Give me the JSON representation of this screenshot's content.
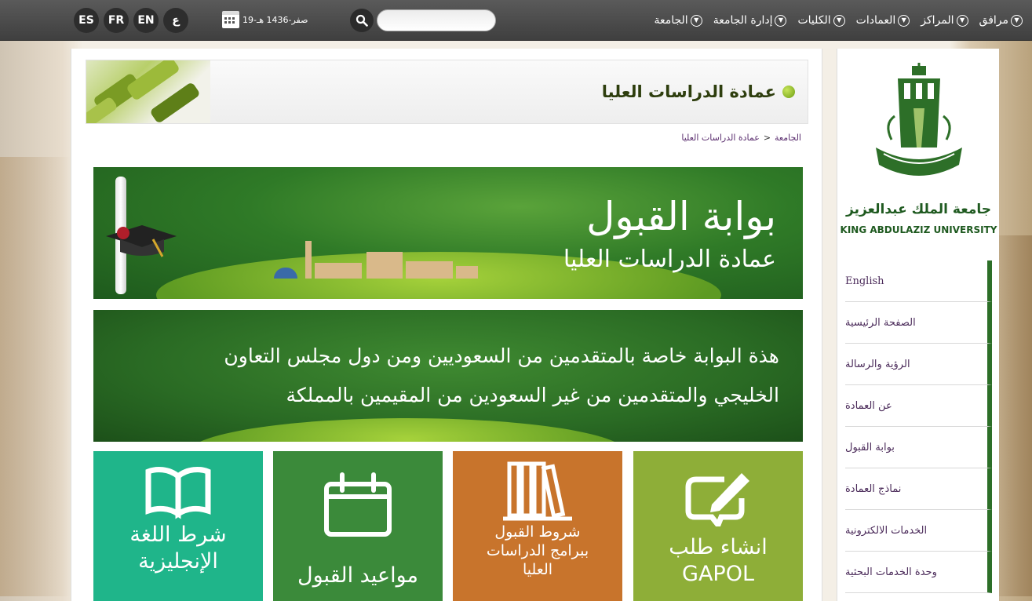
{
  "topbar": {
    "nav": [
      {
        "label": "الجامعة"
      },
      {
        "label": "إدارة الجامعة"
      },
      {
        "label": "الكليات"
      },
      {
        "label": "العمادات"
      },
      {
        "label": "المراكز"
      },
      {
        "label": "مرافق"
      }
    ],
    "search": {
      "value": "",
      "placeholder": ""
    },
    "date": "19-صفر-1436 هـ",
    "languages": [
      "ES",
      "FR",
      "EN",
      "ع"
    ]
  },
  "page": {
    "title": "عمادة الدراسات العليا",
    "breadcrumb": {
      "root": "الجامعة",
      "separator": ">",
      "current": "عمادة الدراسات العليا"
    }
  },
  "banner": {
    "title": "بوابة القبول",
    "subtitle": "عمادة الدراسات العليا"
  },
  "notice": {
    "line1": "هذة البوابة خاصة بالمتقدمين من السعوديين ومن دول مجلس التعاون",
    "line2": "الخليجي والمتقدمين من غير السعودين من المقيمين بالمملكة"
  },
  "tiles": [
    {
      "label_line1": "انشاء طلب",
      "label_line2": "GAPOL",
      "icon": "pencil-form-icon",
      "color": "#8eae38"
    },
    {
      "label_line1": "شروط القبول",
      "label_line2": "ببرامج الدراسات",
      "label_line3": "العليا",
      "icon": "books-icon",
      "color": "#c8742c"
    },
    {
      "label_line1": "مواعيد القبول",
      "icon": "calendar-icon",
      "color": "#3b8a3a"
    },
    {
      "label_line1": "شرط اللغة",
      "label_line2": "الإنجليزية",
      "icon": "open-book-icon",
      "color": "#1fb58a"
    }
  ],
  "sidebar": {
    "university_ar": "جامعة الملك عبدالعزيز",
    "university_en": "KING ABDULAZIZ UNIVERSITY",
    "menu": [
      {
        "label": "English"
      },
      {
        "label": "الصفحة الرئيسية"
      },
      {
        "label": "الرؤية والرسالة"
      },
      {
        "label": "عن العمادة"
      },
      {
        "label": "بوابة القبول"
      },
      {
        "label": "نماذج العمادة"
      },
      {
        "label": "الخدمات الالكترونية"
      },
      {
        "label": "وحدة الخدمات البحثية"
      }
    ]
  },
  "colors": {
    "topbar": "#4a4a4a",
    "accent_green": "#2d6f28",
    "menu_text": "#4b2b5a"
  }
}
